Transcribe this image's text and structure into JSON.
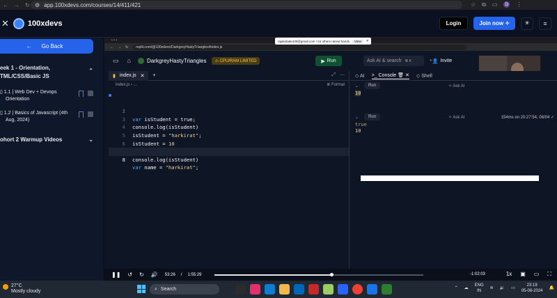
{
  "browser": {
    "url": "app.100xdevs.com/courses/14/411/421"
  },
  "header": {
    "brand": "100xdevs",
    "login_label": "Login",
    "join_label": "Join now"
  },
  "sidebar": {
    "back_label": "Go Back",
    "week_title_line1": "eek 1 - Orientation,",
    "week_title_line2": "TML/CSS/Basic JS",
    "lessons": [
      {
        "line1": "1.1 | Web Dev + Devops",
        "line2": "Orientation"
      },
      {
        "line1": "1.2 | Basics of Javascript (4th",
        "line2": "Aug, 2024)"
      }
    ],
    "cohort_title": "ohort 2 Warmup Videos"
  },
  "replit": {
    "notif_text": "rajakolade430@gmail.com +24 others raised hands",
    "notif_view": "View",
    "inner_url": "replit.com/@100xdevs/DarkgreyHastyTriangles#index.js",
    "repl_name": "DarkgreyHastyTriangles",
    "cpu_badge": "CPU/RAM LIMITED",
    "run_label": "Run",
    "ask_ai_label": "Ask AI & search",
    "ask_ai_shortcut": "⌘ K",
    "invite_label": "Invite",
    "file_tab": "index.js",
    "breadcrumb": "index.js › ...",
    "format_label": "Format",
    "code_lines": [
      {
        "n": "1",
        "text": ""
      },
      {
        "n": "2",
        "kw": "var",
        "rest": " isStudent = true;"
      },
      {
        "n": "3",
        "text": "console.log(isStudent)"
      },
      {
        "n": "4",
        "pre": "isStudent = ",
        "str": "\"harkirat\"",
        "post": ";"
      },
      {
        "n": "5",
        "pre": "isStudent = ",
        "str": "10",
        "post": ""
      },
      {
        "n": "6",
        "text": ""
      },
      {
        "n": "7",
        "text": "console.log(isStudent)"
      },
      {
        "n": "8",
        "kw": "var",
        "rest": " name = ",
        "str": "\"harkirat\"",
        "post": ";"
      }
    ],
    "right_tabs": [
      "AI",
      "Console",
      "Shell"
    ],
    "run_chip": "Run",
    "ask_ai_chip": "Ask AI",
    "timing": "154ms on 20:27:54, 08/04",
    "output_first": "10",
    "output_second": [
      "true",
      "10"
    ]
  },
  "video": {
    "current_time": "53:26",
    "separator": "/",
    "duration": "1:55:29",
    "remaining": "-1:02:03",
    "speed": "1x",
    "progress_fraction": 0.56
  },
  "taskbar": {
    "temp": "27°C",
    "weather": "Mostly cloudy",
    "search_label": "Search",
    "lang_top": "ENG",
    "lang_bottom": "IN",
    "time": "23:19",
    "date": "05-08-2024"
  },
  "colors": {
    "accent": "#2563eb",
    "run_green": "#0f5132",
    "string_yellow": "#f6d28b",
    "keyword_blue": "#57abff"
  }
}
